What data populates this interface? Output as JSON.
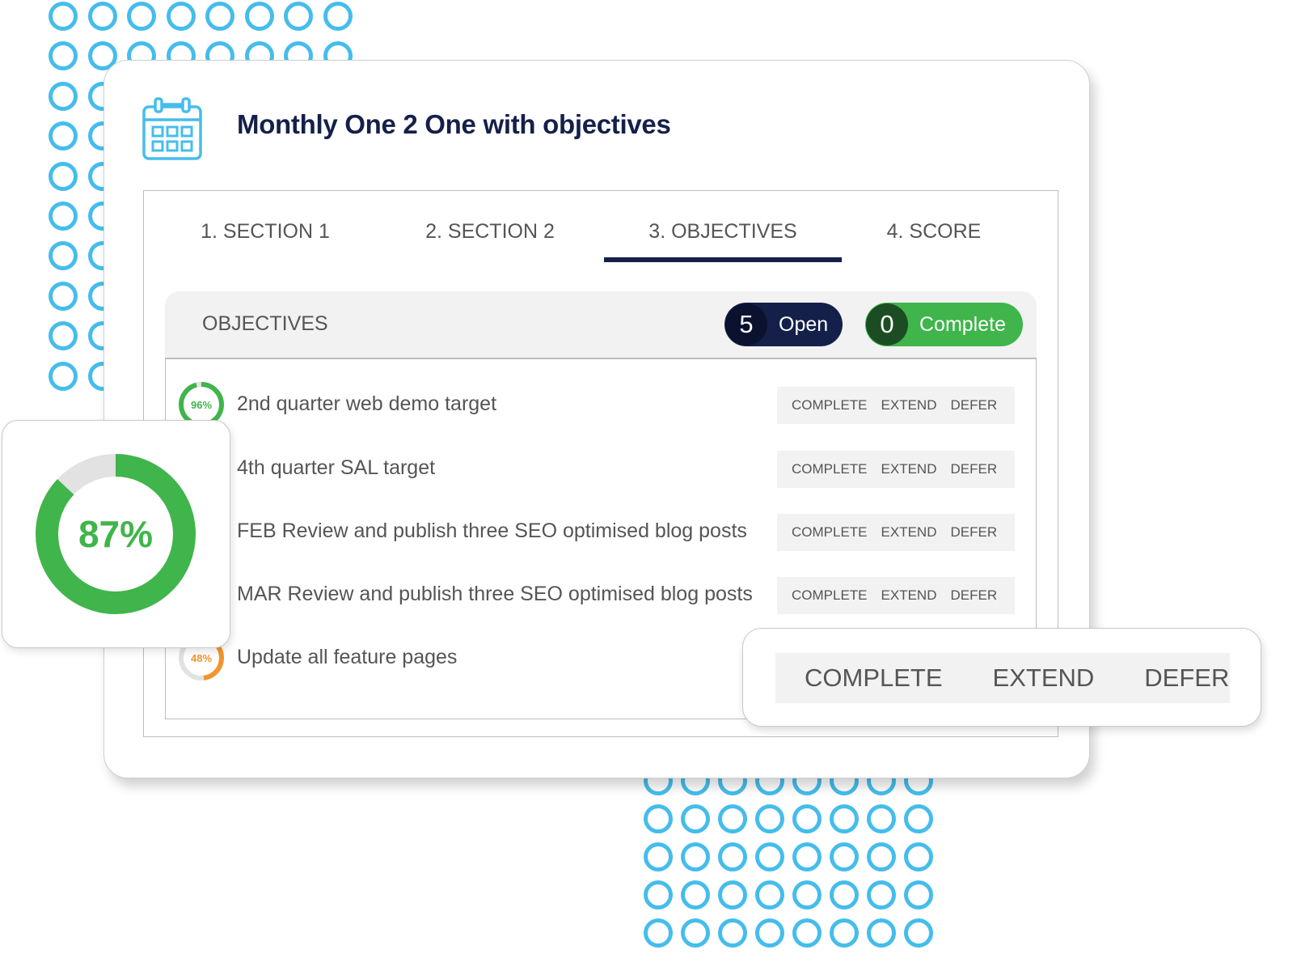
{
  "page": {
    "title": "Monthly One 2 One with objectives",
    "icon": "calendar-icon"
  },
  "tabs": [
    {
      "label": "1. SECTION 1",
      "active": false
    },
    {
      "label": "2. SECTION 2",
      "active": false
    },
    {
      "label": "3. OBJECTIVES",
      "active": true
    },
    {
      "label": "4. SCORE",
      "active": false
    }
  ],
  "objectives": {
    "heading": "OBJECTIVES",
    "open": {
      "count": "5",
      "label": "Open"
    },
    "complete": {
      "count": "0",
      "label": "Complete"
    },
    "actions": {
      "complete": "COMPLETE",
      "extend": "EXTEND",
      "defer": "DEFER"
    },
    "items": [
      {
        "label": "2nd quarter web demo target",
        "progress_text": "96%",
        "progress": 0.96,
        "color": "#3fb54b"
      },
      {
        "label": "4th quarter SAL target"
      },
      {
        "label": "FEB Review and publish three SEO optimised blog posts"
      },
      {
        "label": "MAR Review and publish three SEO optimised blog posts"
      },
      {
        "label": "Update all feature pages",
        "progress_text": "48%",
        "progress": 0.48,
        "color": "#f2952e"
      }
    ]
  },
  "score": {
    "value_text": "87%",
    "value": 0.87,
    "color": "#3fb54b"
  },
  "callout": {
    "complete": "COMPLETE",
    "extend": "EXTEND",
    "defer": "DEFER"
  },
  "colors": {
    "navy": "#14204a",
    "green": "#3fb54b",
    "orange": "#f2952e",
    "dots": "#45bdec"
  }
}
